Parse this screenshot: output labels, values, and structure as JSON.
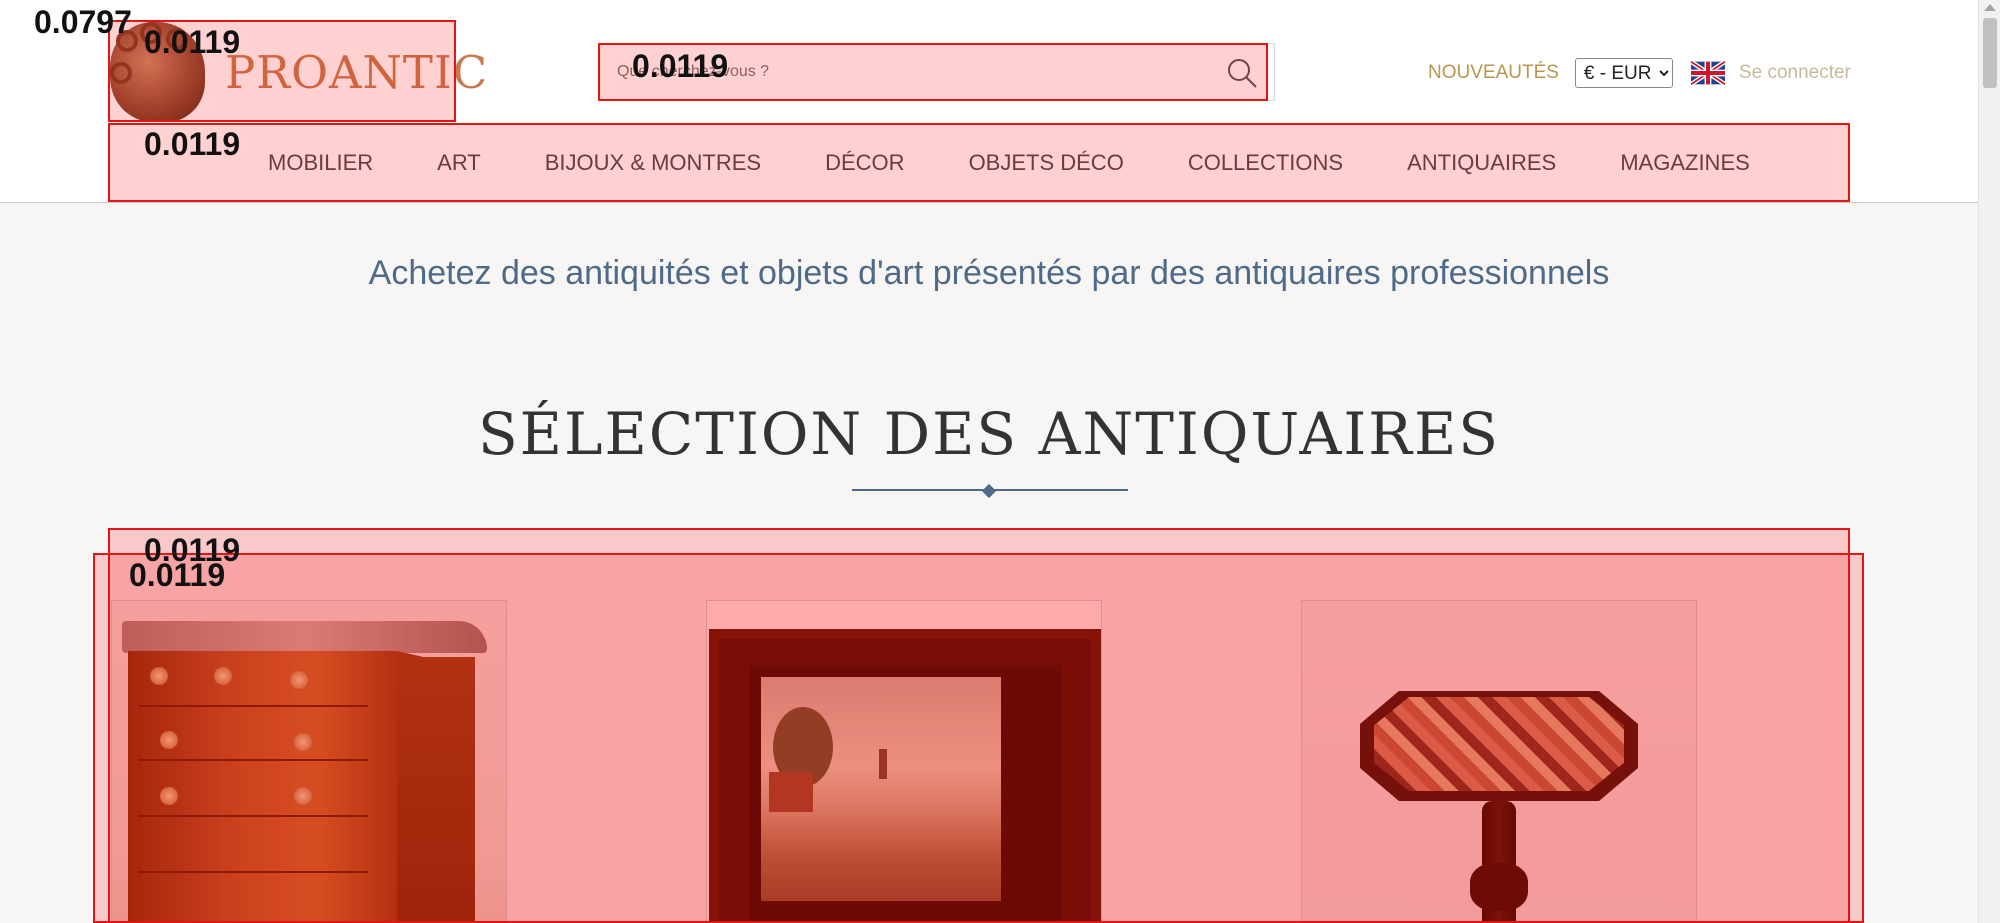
{
  "header": {
    "logo_text": "PROANTIC",
    "search": {
      "placeholder": "Que cherchez-vous ?",
      "value": ""
    },
    "nouveautes": "NOUVEAUTÉS",
    "currency": {
      "selected": "€ - EUR"
    },
    "language_flag": "uk-flag-icon",
    "login": "Se connecter",
    "nav": [
      "MOBILIER",
      "ART",
      "BIJOUX & MONTRES",
      "DÉCOR",
      "OBJETS DÉCO",
      "COLLECTIONS",
      "ANTIQUAIRES",
      "MAGAZINES"
    ]
  },
  "main": {
    "tagline": "Achetez des antiquités et objets d'art présentés par des antiquaires professionnels",
    "section_title": "SÉLECTION DES ANTIQUAIRES"
  },
  "overlay_labels": [
    "0.0797",
    "0.0119",
    "0.0119",
    "0.0119",
    "0.0119",
    "0.0119"
  ],
  "colors": {
    "accent_gold": "#b8964f",
    "nav_text": "#4a4a4a",
    "tagline_blue": "#4e6a89",
    "logo_copper": "#c67a4e",
    "highlight_red": "#e31515"
  }
}
